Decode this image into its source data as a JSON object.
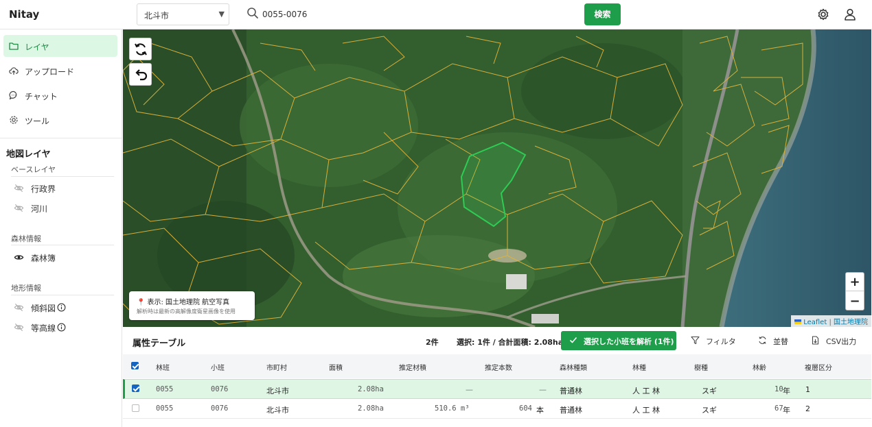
{
  "app": {
    "title": "Nitay"
  },
  "header": {
    "city_select": "北斗市",
    "search_value": "0055-0076",
    "search_button": "検索"
  },
  "sidebar": {
    "nav": [
      {
        "label": "レイヤ",
        "icon": "folder-icon",
        "active": true
      },
      {
        "label": "アップロード",
        "icon": "upload-cloud-icon",
        "active": false
      },
      {
        "label": "チャット",
        "icon": "chat-bubble-icon",
        "active": false
      },
      {
        "label": "ツール",
        "icon": "tool-icon",
        "active": false
      }
    ],
    "map_layers_title": "地図レイヤ",
    "groups": [
      {
        "title": "ベースレイヤ",
        "items": [
          {
            "label": "行政界",
            "visible": false,
            "info": false
          },
          {
            "label": "河川",
            "visible": false,
            "info": false
          }
        ]
      },
      {
        "title": "森林情報",
        "items": [
          {
            "label": "森林簿",
            "visible": true,
            "info": false
          }
        ]
      },
      {
        "title": "地形情報",
        "items": [
          {
            "label": "傾斜図",
            "visible": false,
            "info": true
          },
          {
            "label": "等高線",
            "visible": false,
            "info": true
          }
        ]
      }
    ]
  },
  "map": {
    "refresh_icon": "refresh-icon",
    "undo_icon": "undo-icon",
    "zoom_in": "+",
    "zoom_out": "−",
    "attribution_leaflet": "Leaflet",
    "attribution_sep": " | ",
    "attribution_gsi": "国土地理院",
    "note_title": "表示: 国土地理院 航空写真",
    "note_sub": "解析時は最新の高解像度衛星画像を使用",
    "colors": {
      "polygon_outline": "#e0b43c",
      "selected_polygon": "#2ecc54"
    }
  },
  "attr_table": {
    "title": "属性テーブル",
    "count": "2件",
    "selection": "選択: 1件 / 合計面積: 2.08ha",
    "analyze_button": "選択した小班を解析 (1件)",
    "filter_button": "フィルタ",
    "sort_button": "並替",
    "csv_button": "CSV出力",
    "columns": [
      "林班",
      "小班",
      "市町村",
      "面積",
      "推定材積",
      "推定本数",
      "森林種類",
      "林種",
      "樹種",
      "林齢",
      "複層区分"
    ],
    "rows": [
      {
        "checked": true,
        "rinpan": "0055",
        "shohan": "0076",
        "city": "北斗市",
        "area": "2.08ha",
        "volume": "—",
        "count_num": "",
        "count_unit": "—",
        "forest_type": "普通林",
        "rinshu": "人 工 林",
        "species": "スギ",
        "age_num": "10",
        "age_unit": "年",
        "layer": "1"
      },
      {
        "checked": false,
        "rinpan": "0055",
        "shohan": "0076",
        "city": "北斗市",
        "area": "2.08ha",
        "volume": "510.6 m³",
        "count_num": "604",
        "count_unit": "本",
        "forest_type": "普通林",
        "rinshu": "人 工 林",
        "species": "スギ",
        "age_num": "67",
        "age_unit": "年",
        "layer": "2"
      }
    ]
  }
}
